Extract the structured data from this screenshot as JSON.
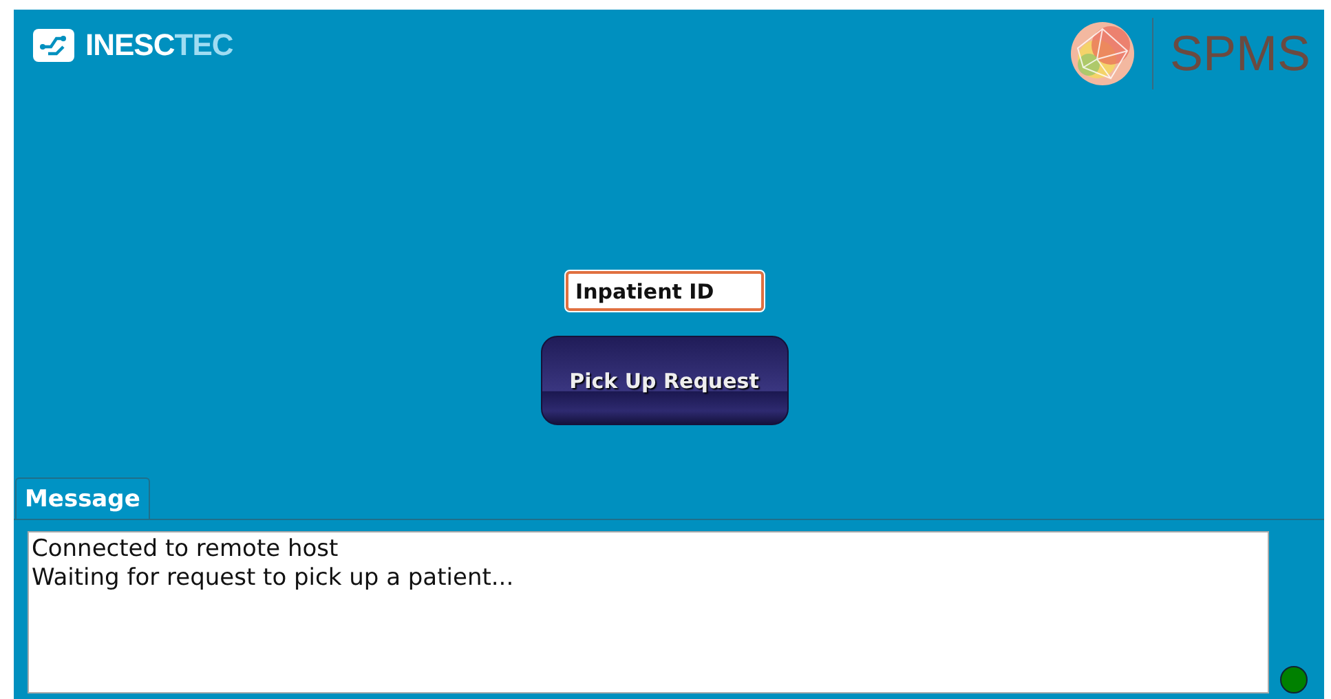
{
  "header": {
    "left_logo": {
      "primary": "INESC",
      "secondary": "TEC"
    },
    "right_logo": {
      "text": "SPMS"
    }
  },
  "form": {
    "inpatient_id": {
      "value": "Inpatient ID"
    },
    "button": "Pick Up Request"
  },
  "message_panel": {
    "tabs": [
      {
        "label": "Message",
        "selected": true
      }
    ],
    "lines": [
      "Connected to remote host",
      "Waiting for request to pick up a patient..."
    ],
    "status": {
      "color": "#008000"
    }
  }
}
